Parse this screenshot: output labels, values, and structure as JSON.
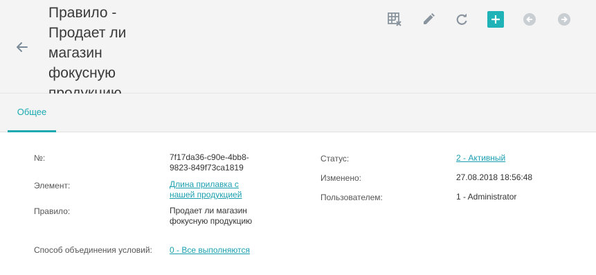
{
  "header": {
    "title": "Правило - Продает ли магазин фокусную продукцию",
    "accent_color": "#1fb3b8"
  },
  "toolbar": {
    "icons": [
      "table-clear-icon",
      "pencil-icon",
      "refresh-icon",
      "plus-icon",
      "arrow-left-circle-icon",
      "arrow-right-circle-icon"
    ]
  },
  "tabs": [
    {
      "label": "Общее",
      "active": true
    }
  ],
  "fields_left": [
    {
      "label": "№:",
      "value": "7f17da36-c90e-4bb8-9823-849f73ca1819",
      "link": false
    },
    {
      "label": "Элемент:",
      "value": "Длина прилавка с нашей продукцией",
      "link": true
    },
    {
      "label": "Правило:",
      "value": "Продает ли магазин фокусную продукцию",
      "link": false
    },
    {
      "label": "Способ объединения условий:",
      "value": "0 - Все выполняются",
      "link": true
    }
  ],
  "fields_right": [
    {
      "label": "Статус:",
      "value": "2 - Активный",
      "link": true
    },
    {
      "label": "Изменено:",
      "value": "27.08.2018 18:56:48",
      "link": false
    },
    {
      "label": "Пользователем:",
      "value": "1 - Administrator",
      "link": false
    }
  ]
}
